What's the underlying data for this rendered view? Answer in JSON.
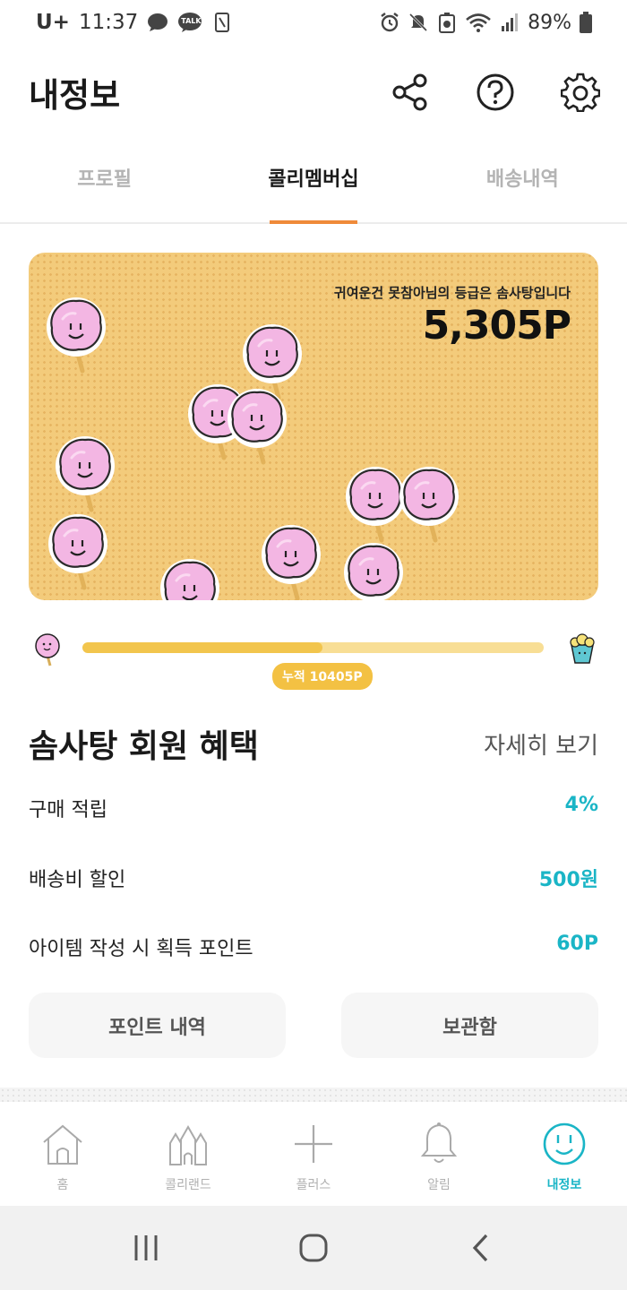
{
  "status_bar": {
    "carrier": "U+",
    "time": "11:37",
    "talk_badge": "TALK",
    "battery": "89%",
    "icons": [
      "chat-bubble-icon",
      "kakaotalk-icon",
      "phone-icon",
      "alarm-icon",
      "mute-icon",
      "battery-saver-icon",
      "wifi-icon",
      "signal-icon",
      "battery-icon"
    ]
  },
  "header": {
    "title": "내정보",
    "icons": [
      "share-icon",
      "help-icon",
      "settings-icon"
    ]
  },
  "tabs": [
    {
      "label": "프로필",
      "active": false
    },
    {
      "label": "콜리멤버십",
      "active": true
    },
    {
      "label": "배송내역",
      "active": false
    }
  ],
  "card": {
    "grade_text": "귀여운건 못참아님의 등급은 솜사탕입니다",
    "points": "5,305P",
    "background_color": "#f3cb7b",
    "decoration_icon": "cotton-candy-icon"
  },
  "progress": {
    "fraction": 0.52,
    "badge": "누적 10405P",
    "start_icon": "cotton-candy-icon",
    "end_icon": "popcorn-icon",
    "fill_color": "#f2c54d"
  },
  "benefits": {
    "title": "솜사탕 회원 혜택",
    "detail_link": "자세히 보기",
    "rows": [
      {
        "label": "구매 적립",
        "value": "4%"
      },
      {
        "label": "배송비 할인",
        "value": "500원"
      },
      {
        "label": "아이템 작성 시 획득 포인트",
        "value": "60P"
      }
    ],
    "accent_color": "#1ab5c6"
  },
  "actions": {
    "points_history": "포인트 내역",
    "storage": "보관함"
  },
  "bottom_nav": [
    {
      "label": "홈",
      "icon": "home-icon",
      "active": false
    },
    {
      "label": "콜리랜드",
      "icon": "castle-icon",
      "active": false
    },
    {
      "label": "플러스",
      "icon": "plus-icon",
      "active": false
    },
    {
      "label": "알림",
      "icon": "bell-icon",
      "active": false
    },
    {
      "label": "내정보",
      "icon": "smile-face-icon",
      "active": true
    }
  ],
  "system_nav": [
    "recent-apps-icon",
    "home-button-icon",
    "back-icon"
  ]
}
